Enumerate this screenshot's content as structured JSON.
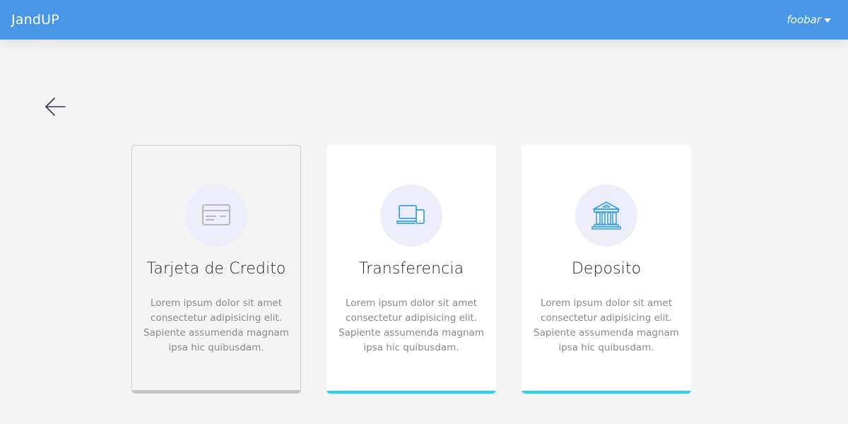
{
  "header": {
    "brand": "JandUP",
    "user": "foobar"
  },
  "options": [
    {
      "title": "Tarjeta de Credito",
      "description": "Lorem ipsum dolor sit amet consectetur adipisicing elit. Sapiente assumenda magnam ipsa hic quibusdam.",
      "icon": "credit-card-icon",
      "selected": true
    },
    {
      "title": "Transferencia",
      "description": "Lorem ipsum dolor sit amet consectetur adipisicing elit. Sapiente assumenda magnam ipsa hic quibusdam.",
      "icon": "devices-icon",
      "selected": false
    },
    {
      "title": "Deposito",
      "description": "Lorem ipsum dolor sit amet consectetur adipisicing elit. Sapiente assumenda magnam ipsa hic quibusdam.",
      "icon": "bank-icon",
      "selected": false
    }
  ],
  "colors": {
    "header": "#4a96e6",
    "accent": "#22d6ee",
    "selected_bar": "#c4c4c4",
    "icon_blue": "#3aa0f0",
    "icon_gray": "#b8b8b8"
  }
}
